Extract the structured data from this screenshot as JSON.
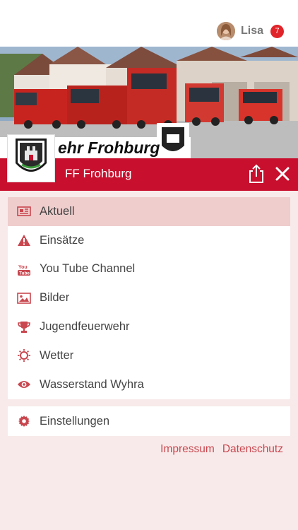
{
  "user": {
    "name": "Lisa",
    "notification_count": "7"
  },
  "header": {
    "banner_text": "ehr Frohburg",
    "title": "FF Frohburg"
  },
  "menu": {
    "items": [
      {
        "label": "Aktuell",
        "icon": "newspaper-icon",
        "active": true
      },
      {
        "label": "Einsätze",
        "icon": "warning-icon"
      },
      {
        "label": "You Tube Channel",
        "icon": "youtube-icon"
      },
      {
        "label": "Bilder",
        "icon": "image-icon"
      },
      {
        "label": "Jugendfeuerwehr",
        "icon": "trophy-icon"
      },
      {
        "label": "Wetter",
        "icon": "sun-icon"
      },
      {
        "label": "Wasserstand Wyhra",
        "icon": "eye-icon"
      }
    ]
  },
  "settings": {
    "label": "Einstellungen",
    "icon": "gear-icon"
  },
  "footer": {
    "impressum": "Impressum",
    "datenschutz": "Datenschutz"
  },
  "colors": {
    "accent": "#c8102e",
    "icon": "#c9474f",
    "active_bg": "#efcdcd",
    "page_bg": "#f8eaea"
  }
}
